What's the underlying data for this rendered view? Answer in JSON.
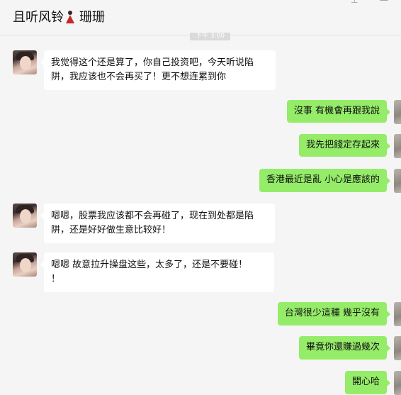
{
  "header": {
    "title_name": "且听风铃",
    "title_contact": "珊珊",
    "emoji_icon": "woman-dancing-emoji",
    "pin_glyph": "⊥",
    "minimize_glyph": "—"
  },
  "timestamp_chip": "下午 3:00",
  "colors": {
    "incoming_bubble": "#ffffff",
    "outgoing_bubble": "#95ec69",
    "background": "#f5f5f5"
  },
  "messages": [
    {
      "side": "in",
      "lines": [
        "我觉得这个还是算了，你自己投资吧，今天听说陷",
        "阱，我应该也不会再买了！更不想连累到你"
      ]
    },
    {
      "side": "out",
      "text": "沒事  有機會再跟我說"
    },
    {
      "side": "out",
      "text": "我先把錢定存起來"
    },
    {
      "side": "out",
      "text": "香港最近是亂 小心是應該的"
    },
    {
      "side": "in",
      "lines": [
        "嗯嗯，股票我应该都不会再碰了，现在到处都是陷",
        "阱，还是好好做生意比较好！"
      ]
    },
    {
      "side": "in",
      "lines": [
        "嗯嗯   故意拉升操盘这些，太多了，还是不要碰！",
        "！"
      ]
    },
    {
      "side": "out",
      "text": "台灣很少這種 幾乎沒有"
    },
    {
      "side": "out",
      "text": "畢竟你還賺過幾次"
    },
    {
      "side": "out",
      "text": "開心哈"
    }
  ]
}
